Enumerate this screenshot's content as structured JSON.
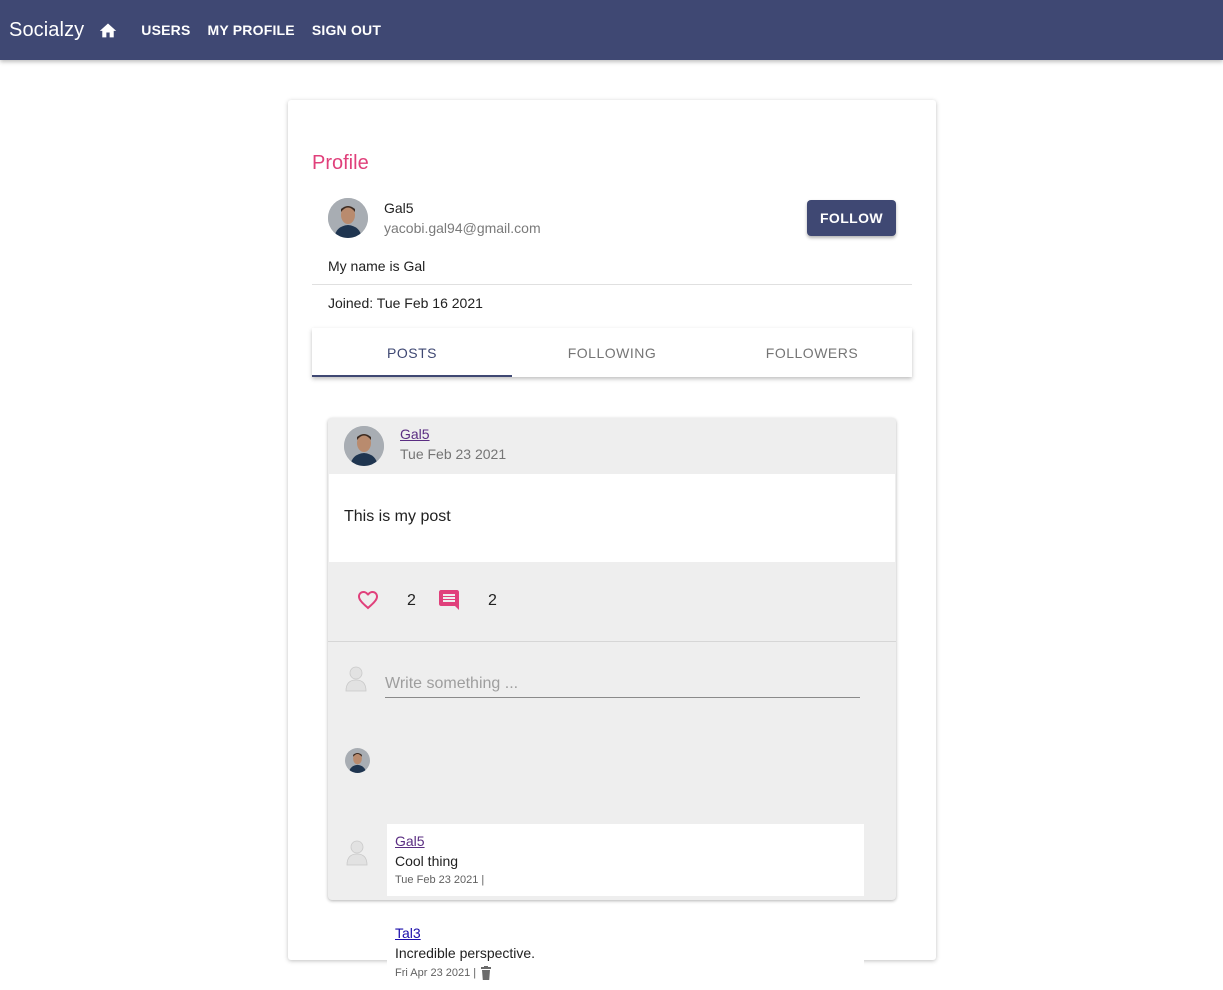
{
  "app": {
    "brand": "Socialzy",
    "nav": {
      "users": "USERS",
      "my_profile": "MY PROFILE",
      "sign_out": "SIGN OUT"
    },
    "colors": {
      "primary": "#3f4873",
      "accent": "#e0407b"
    }
  },
  "profile": {
    "title": "Profile",
    "name": "Gal5",
    "email": "yacobi.gal94@gmail.com",
    "follow_label": "FOLLOW",
    "about": "My name is Gal",
    "joined": "Joined: Tue Feb 16 2021"
  },
  "tabs": [
    {
      "label": "POSTS",
      "active": true
    },
    {
      "label": "FOLLOWING",
      "active": false
    },
    {
      "label": "FOLLOWERS",
      "active": false
    }
  ],
  "post": {
    "author": "Gal5",
    "date": "Tue Feb 23 2021",
    "text": "This is my post",
    "likes": "2",
    "comments_count": "2",
    "write_placeholder": "Write something ...",
    "comments": [
      {
        "author": "Gal5",
        "text": "Cool thing",
        "meta": "Tue Feb 23 2021 |",
        "deletable": false
      },
      {
        "author": "Tal3",
        "text": "Incredible perspective.",
        "meta": "Fri Apr 23 2021 |",
        "deletable": true
      }
    ]
  }
}
